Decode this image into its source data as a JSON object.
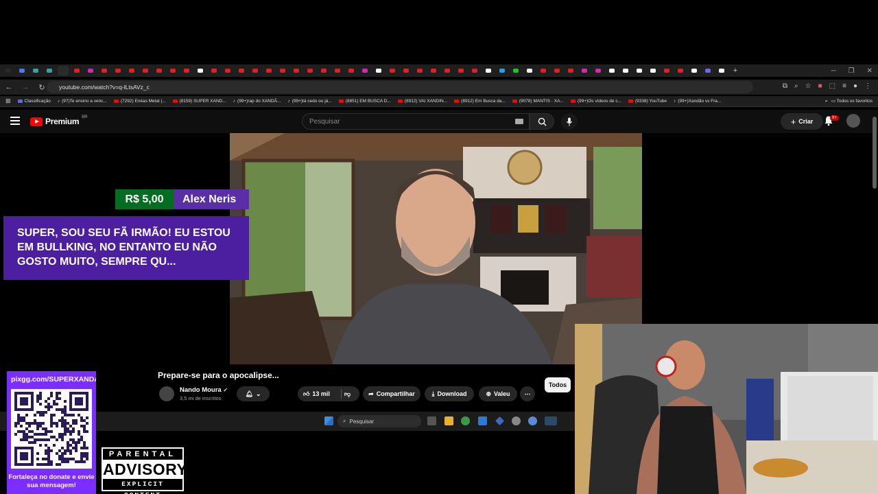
{
  "browser": {
    "url": "youtube.com/watch?v=q-lLtsAVz_c",
    "bookmarks": [
      "Classificação",
      "(97)Te ensino a venc...",
      "(7292) Enéas Metal |...",
      "(8159) SUPER XAND...",
      "(99+)rap do XANDÃ...",
      "(99+)tá cedo ou já...",
      "(8851) EM BUSCA D...",
      "(8912) VAI XANDIN...",
      "(8912) Em Busca da...",
      "(9078) MANTIS · XA...",
      "(99+)Os vídeos de c...",
      "(9338) YouTube",
      "(99+)Xandão vs Fra..."
    ],
    "all_bookmarks": "Todos os favoritos"
  },
  "youtube": {
    "logo_text": "Premium",
    "country": "BR",
    "search_placeholder": "Pesquisar",
    "create_label": "Criar",
    "notif_badge": "9+"
  },
  "superchat": {
    "amount": "R$ 5,00",
    "name": "Alex Neris",
    "message": "SUPER, SOU SEU FÃ IRMÃO! EU ESTOU EM BULLKING, NO ENTANTO EU NÃO GOSTO MUITO, SEMPRE QU..."
  },
  "video": {
    "title": "Prepare-se para o apocalipse...",
    "channel": "Nando Moura",
    "subscribers": "3,5 mi de inscritos",
    "likes": "13 mil",
    "share": "Compartilhar",
    "download": "Download",
    "thanks": "Valeu",
    "filter": "Todos"
  },
  "taskbar": {
    "search": "Pesquisar"
  },
  "overlay": {
    "pix_url": "pixgg.com/SUPERXANDAO",
    "donate_text": "Fortaleça no donate e envie sua mensagem!",
    "pa_top": "PARENTAL",
    "pa_mid": "ADVISORY",
    "pa_bot": "EXPLICIT CONTENT"
  }
}
